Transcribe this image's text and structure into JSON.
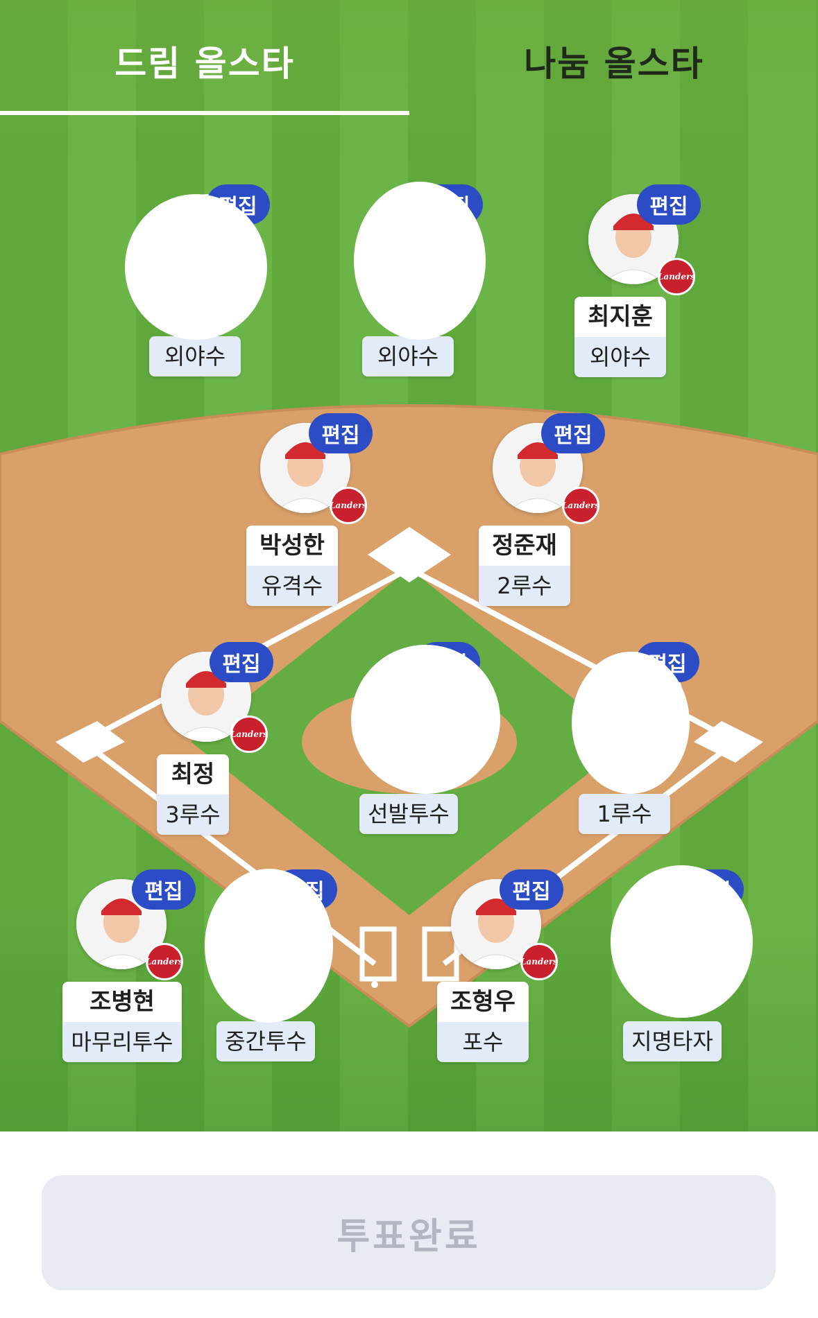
{
  "tabs": [
    {
      "label": "드림 올스타",
      "active": true
    },
    {
      "label": "나눔 올스타",
      "active": false
    }
  ],
  "edit_label": "편집",
  "team_badge": "Landers",
  "positions": {
    "lf": {
      "name": "",
      "position": "외야수"
    },
    "cf": {
      "name": "",
      "position": "외야수"
    },
    "rf": {
      "name": "최지훈",
      "position": "외야수"
    },
    "ss": {
      "name": "박성한",
      "position": "유격수"
    },
    "2b": {
      "name": "정준재",
      "position": "2루수"
    },
    "3b": {
      "name": "최정",
      "position": "3루수"
    },
    "sp": {
      "name": "",
      "position": "선발투수"
    },
    "1b": {
      "name": "",
      "position": "1루수"
    },
    "cl": {
      "name": "조병현",
      "position": "마무리투수"
    },
    "rp": {
      "name": "",
      "position": "중간투수"
    },
    "c": {
      "name": "조형우",
      "position": "포수"
    },
    "dh": {
      "name": "",
      "position": "지명타자"
    }
  },
  "complete_button": "투표완료",
  "colors": {
    "grass": "#6bb447",
    "infield_dirt": "#d9a06a",
    "edit_badge": "#2b4cc4",
    "position_bg": "#e3ebf8",
    "team_badge": "#c9202d",
    "button_bg": "#e8ebf2",
    "button_text": "#b1b6c1"
  }
}
